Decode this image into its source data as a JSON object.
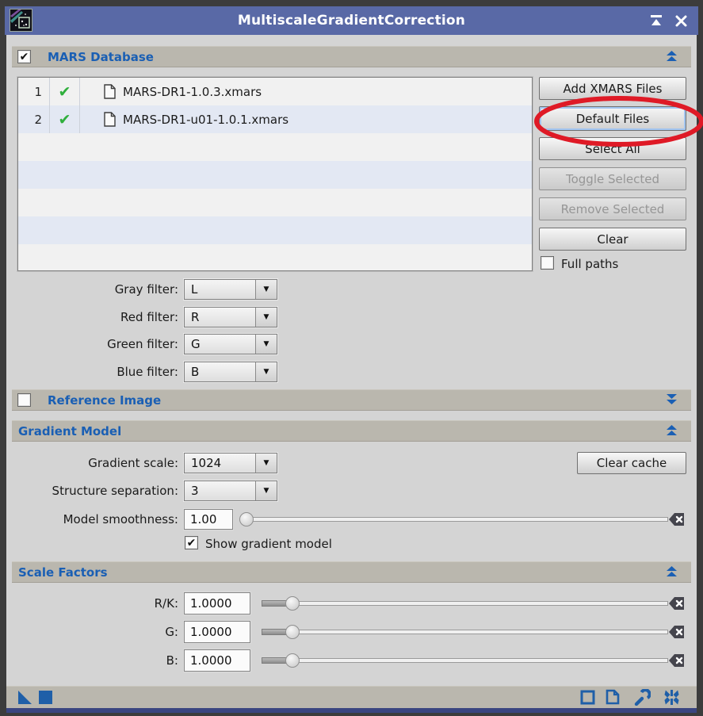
{
  "window": {
    "title": "MultiscaleGradientCorrection",
    "titlebar_color": "#5969a6"
  },
  "glyphs": {
    "check": "✔",
    "combo_arrow": "▼"
  },
  "colors": {
    "accent_blue": "#1a5fb4",
    "annotation_red": "#df1a26",
    "footer_icon_blue": "#1f5fa8",
    "list_check_green": "#2faf3c"
  },
  "sections": {
    "mars": {
      "title": "MARS Database",
      "checked": true,
      "files": [
        {
          "index": "1",
          "name": "MARS-DR1-1.0.3.xmars"
        },
        {
          "index": "2",
          "name": "MARS-DR1-u01-1.0.1.xmars"
        }
      ],
      "buttons": {
        "add": "Add XMARS Files",
        "default": "Default Files",
        "select_all": "Select All",
        "toggle": "Toggle Selected",
        "remove": "Remove Selected",
        "clear": "Clear"
      },
      "full_paths_label": "Full paths",
      "filters": [
        {
          "label": "Gray filter:",
          "value": "L"
        },
        {
          "label": "Red filter:",
          "value": "R"
        },
        {
          "label": "Green filter:",
          "value": "G"
        },
        {
          "label": "Blue filter:",
          "value": "B"
        }
      ]
    },
    "reference": {
      "title": "Reference Image",
      "checked": false
    },
    "gradient": {
      "title": "Gradient Model",
      "scale_label": "Gradient scale:",
      "scale_value": "1024",
      "separation_label": "Structure separation:",
      "separation_value": "3",
      "smoothness_label": "Model smoothness:",
      "smoothness_value": "1.00",
      "show_label": "Show gradient model",
      "show_checked": true,
      "clear_cache_label": "Clear cache"
    },
    "scale_factors": {
      "title": "Scale Factors",
      "rows": [
        {
          "label": "R/K:",
          "value": "1.0000"
        },
        {
          "label": "G:",
          "value": "1.0000"
        },
        {
          "label": "B:",
          "value": "1.0000"
        }
      ]
    }
  },
  "annotation": {
    "shape": "ellipse",
    "color": "#df1a26",
    "highlights": "Default Files"
  }
}
